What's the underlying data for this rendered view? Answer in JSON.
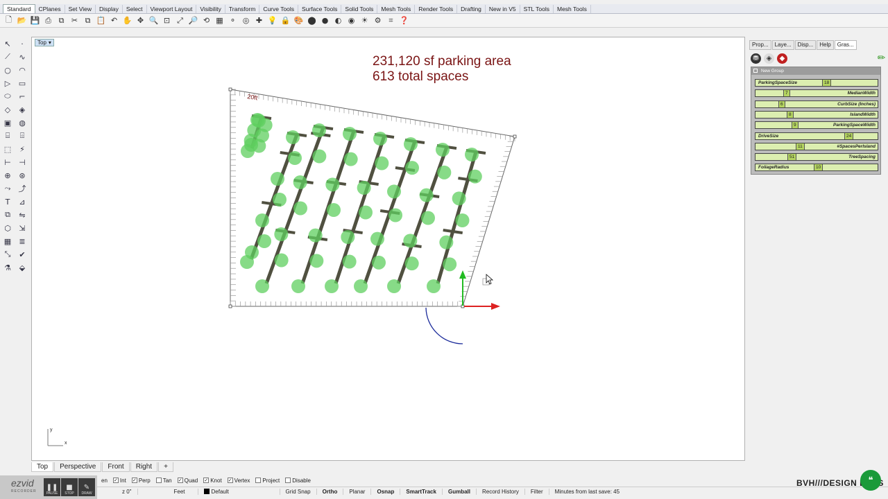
{
  "menu_tabs": [
    "Standard",
    "CPlanes",
    "Set View",
    "Display",
    "Select",
    "Viewport Layout",
    "Visibility",
    "Transform",
    "Curve Tools",
    "Surface Tools",
    "Solid Tools",
    "Mesh Tools",
    "Render Tools",
    "Drafting",
    "New in V5",
    "STL Tools",
    "Mesh Tools"
  ],
  "viewport": {
    "title": "Top",
    "stats_line1": "231,120 sf parking area",
    "stats_line2": "613 total spaces",
    "corner_label": "20ft",
    "axis_y": "y",
    "axis_x": "x"
  },
  "viewport_tabs": [
    "Top",
    "Perspective",
    "Front",
    "Right",
    "+"
  ],
  "osnaps": [
    {
      "label": "en",
      "checked": true
    },
    {
      "label": "Int",
      "checked": true
    },
    {
      "label": "Perp",
      "checked": true
    },
    {
      "label": "Tan",
      "checked": false
    },
    {
      "label": "Quad",
      "checked": true
    },
    {
      "label": "Knot",
      "checked": true
    },
    {
      "label": "Vertex",
      "checked": true
    },
    {
      "label": "Project",
      "checked": false
    },
    {
      "label": "Disable",
      "checked": false
    }
  ],
  "statusbar": {
    "z": "z 0\"",
    "units": "Feet",
    "layer": "Default",
    "grid_snap": "Grid Snap",
    "ortho": "Ortho",
    "planar": "Planar",
    "osnap": "Osnap",
    "smarttrack": "SmartTrack",
    "gumball": "Gumball",
    "record_history": "Record History",
    "filter": "Filter",
    "last_save": "Minutes from last save: 45"
  },
  "recorder": {
    "logo": "ezvid",
    "sub": "RECORDER",
    "pause": "PAUSE",
    "stop": "STOP",
    "draw": "DRAW"
  },
  "panel_tabs": [
    "Prop...",
    "Laye...",
    "Disp...",
    "Help",
    "Gras..."
  ],
  "gh_group": {
    "name": "New Group",
    "sliders": [
      {
        "label": "ParkingSpaceSize",
        "value": "18",
        "align": "left"
      },
      {
        "label": "MedianWidth",
        "value": "7",
        "align": "right"
      },
      {
        "label": "CurbSize (Inches)",
        "value": "6",
        "align": "right"
      },
      {
        "label": "IslandWidth",
        "value": "8",
        "align": "right"
      },
      {
        "label": "ParkingSpaceWidth",
        "value": "9",
        "align": "right"
      },
      {
        "label": "DriveSize",
        "value": "24",
        "align": "left"
      },
      {
        "label": "#SpacesPerIsland",
        "value": "11",
        "align": "right"
      },
      {
        "label": "TreeSpacing",
        "value": "51",
        "align": "right"
      },
      {
        "label": "FoliageRadius",
        "value": "10",
        "align": "left"
      }
    ]
  },
  "brand": "BVH///DESIGN LABS",
  "colors": {
    "stats_text": "#7a1414",
    "tree": "#5fcf5f",
    "island": "#505040",
    "slider_bg": "#dceeb0",
    "gumball_y": "#22bb22",
    "gumball_x": "#dd2222"
  }
}
